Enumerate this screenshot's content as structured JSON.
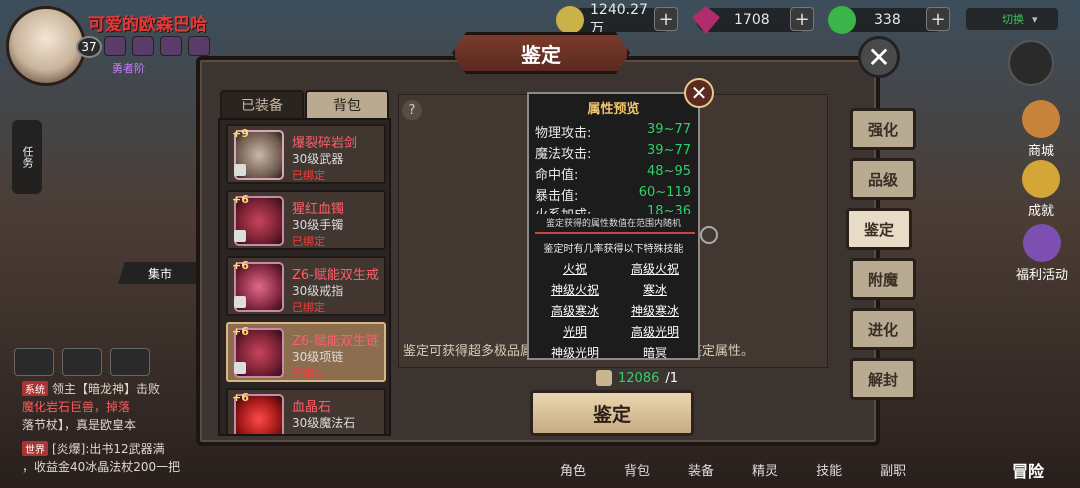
{
  "player": {
    "name": "可爱的欧森巴哈",
    "level": "37",
    "vip_label": "勇者阶"
  },
  "resources": {
    "gold": "1240.27万",
    "gems": "1708",
    "stamina": "338"
  },
  "server_switch_label": "切换",
  "left_ui": {
    "task_label": "任务",
    "market_label": "集市",
    "chat_lines": [
      {
        "tag": "系统",
        "text": "领主【暗龙神】击败"
      },
      {
        "tag": "",
        "text": "魔化岩石巨兽，掉落"
      },
      {
        "tag": "",
        "text": "落节杖】，真是欧皇本"
      },
      {
        "tag": "世界",
        "text": "[炎爆]:出书12武器满"
      },
      {
        "tag": "",
        "text": "，收益金40冰晶法杖200一把"
      }
    ]
  },
  "right_ui": {
    "shop_label": "商城",
    "achievement_label": "成就",
    "welfare_label": "福利活动"
  },
  "bottom_nav": [
    "角色",
    "背包",
    "装备",
    "精灵",
    "技能",
    "副职"
  ],
  "adventure_label": "冒险",
  "panel": {
    "title": "鉴定",
    "tabs": [
      "已装备",
      "背包"
    ],
    "side_tabs": [
      "强化",
      "品级",
      "鉴定",
      "附魔",
      "进化",
      "解封"
    ],
    "active_side_tab": "鉴定",
    "info_text": "鉴定可获得超多极品属性，鉴定消耗鉴定卷轴进行鉴定属性。",
    "cost_current": "12086",
    "cost_total": "/1",
    "identify_button": "鉴定"
  },
  "items": [
    {
      "plus": "+9",
      "name": "爆裂碎岩剑",
      "type": "30级武器",
      "bound": "已绑定"
    },
    {
      "plus": "+6",
      "name": "猩红血镯",
      "type": "30级手镯",
      "bound": "已绑定"
    },
    {
      "plus": "+6",
      "name": "Z6-赋能双生戒",
      "type": "30级戒指",
      "bound": "已绑定"
    },
    {
      "plus": "+6",
      "name": "Z6-赋能双生链",
      "type": "30级项链",
      "bound": "已绑定"
    },
    {
      "plus": "+6",
      "name": "血晶石",
      "type": "30级魔法石",
      "bound": ""
    }
  ],
  "selected_item_index": 3,
  "popup": {
    "title": "属性预览",
    "stats": [
      {
        "label": "物理攻击:",
        "value": "39~77"
      },
      {
        "label": "魔法攻击:",
        "value": "39~77"
      },
      {
        "label": "命中值:",
        "value": "48~95"
      },
      {
        "label": "暴击值:",
        "value": "60~119"
      },
      {
        "label": "火系加成:",
        "value": "18~36"
      }
    ],
    "note": "鉴定获得的属性数值在范围内随机",
    "sub_title": "鉴定时有几率获得以下特殊技能",
    "skills": [
      "火祝",
      "高级火祝",
      "神级火祝",
      "寒冰",
      "高级寒冰",
      "神级寒冰",
      "光明",
      "高级光明",
      "神级光明",
      "暗冥"
    ]
  },
  "colors": {
    "accent_green": "#2fd16a",
    "item_name_red": "#ff5e6b",
    "title_gold": "#f0c46a"
  }
}
